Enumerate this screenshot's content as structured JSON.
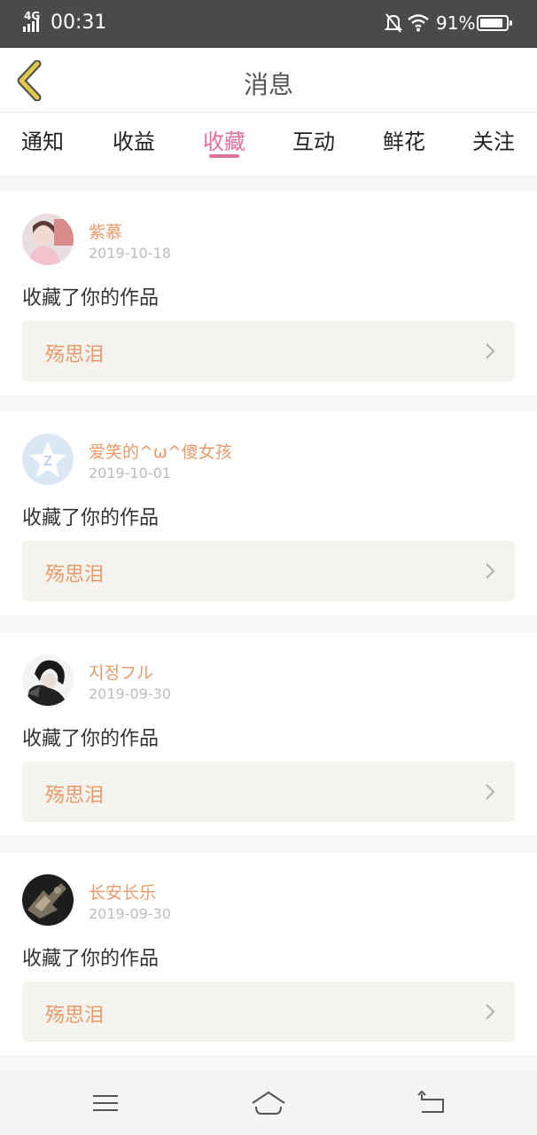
{
  "status_bar": {
    "network": "4G",
    "time": "00:31",
    "battery_text": "91%",
    "battery_level": 0.91
  },
  "header": {
    "title": "消息",
    "back_icon": "back-chevron-icon",
    "accent_color": "#e0c84a"
  },
  "tabs": [
    {
      "label": "通知"
    },
    {
      "label": "收益"
    },
    {
      "label": "收藏"
    },
    {
      "label": "互动"
    },
    {
      "label": "鲜花"
    },
    {
      "label": "关注"
    }
  ],
  "active_tab": "收藏",
  "colors": {
    "active_tab": "#e36f9a",
    "username": "#e99a6a",
    "work_title": "#e99a6a",
    "date": "#bdbdbd",
    "work_box_bg": "#f4f3ed"
  },
  "messages": [
    {
      "username": "紫慕",
      "date": "2019-10-18",
      "action": "收藏了你的作品",
      "work_title": "殇思泪",
      "avatar_icon": "user-photo-avatar"
    },
    {
      "username": "爱笑的^ω^傻女孩",
      "date": "2019-10-01",
      "action": "收藏了你的作品",
      "work_title": "殇思泪",
      "avatar_icon": "qq-default-avatar"
    },
    {
      "username": "지정フル",
      "date": "2019-09-30",
      "action": "收藏了你的作品",
      "work_title": "殇思泪",
      "avatar_icon": "user-photo-avatar"
    },
    {
      "username": "长安长乐",
      "date": "2019-09-30",
      "action": "收藏了你的作品",
      "work_title": "殇思泪",
      "avatar_icon": "user-photo-avatar"
    }
  ],
  "nav_bar": {
    "icons": [
      "menu-icon",
      "home-icon",
      "back-icon"
    ]
  }
}
